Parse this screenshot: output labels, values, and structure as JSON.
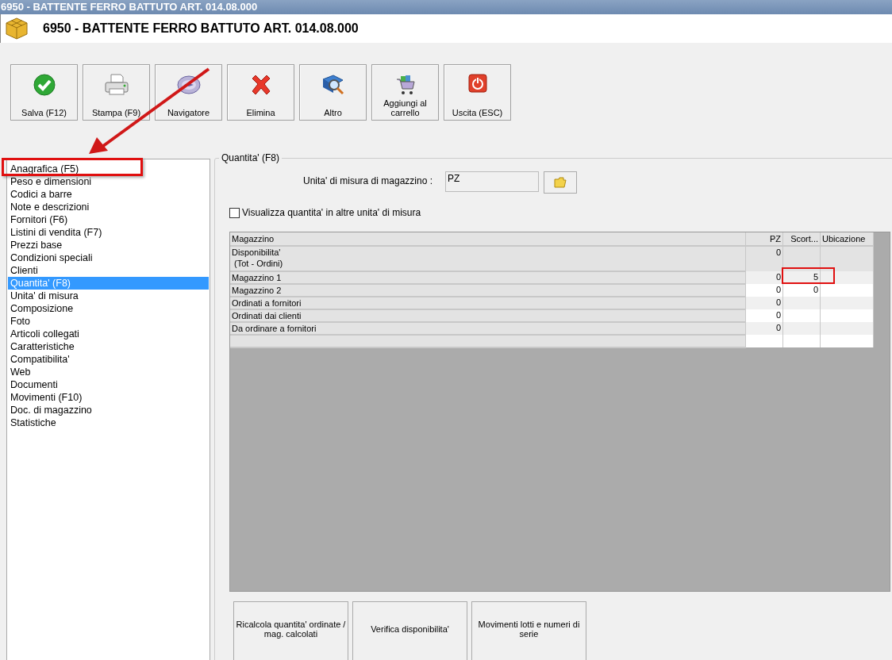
{
  "window": {
    "title": "6950 - BATTENTE FERRO BATTUTO ART. 014.08.000"
  },
  "header": {
    "title": "6950 - BATTENTE FERRO BATTUTO ART. 014.08.000"
  },
  "toolbar": [
    {
      "kind": "save",
      "label": "Salva (F12)"
    },
    {
      "kind": "print",
      "label": "Stampa (F9)"
    },
    {
      "kind": "navigator",
      "label": "Navigatore"
    },
    {
      "kind": "delete",
      "label": "Elimina"
    },
    {
      "kind": "more",
      "label": "Altro"
    },
    {
      "kind": "cart",
      "label": "Aggiungi al carrello"
    },
    {
      "kind": "exit",
      "label": "Uscita (ESC)"
    }
  ],
  "sidebar": {
    "items": [
      {
        "label": "Anagrafica (F5)",
        "selected": false
      },
      {
        "label": "Peso e dimensioni",
        "selected": false
      },
      {
        "label": "Codici a barre",
        "selected": false
      },
      {
        "label": "Note e descrizioni",
        "selected": false
      },
      {
        "label": "Fornitori (F6)",
        "selected": false
      },
      {
        "label": "Listini di vendita (F7)",
        "selected": false
      },
      {
        "label": "Prezzi base",
        "selected": false
      },
      {
        "label": "Condizioni speciali",
        "selected": false
      },
      {
        "label": "Clienti",
        "selected": false
      },
      {
        "label": "Quantita' (F8)",
        "selected": true
      },
      {
        "label": "Unita' di misura",
        "selected": false
      },
      {
        "label": "Composizione",
        "selected": false
      },
      {
        "label": "Foto",
        "selected": false
      },
      {
        "label": "Articoli collegati",
        "selected": false
      },
      {
        "label": "Caratteristiche",
        "selected": false
      },
      {
        "label": "Compatibilita'",
        "selected": false
      },
      {
        "label": "Web",
        "selected": false
      },
      {
        "label": "Documenti",
        "selected": false
      },
      {
        "label": "Movimenti (F10)",
        "selected": false
      },
      {
        "label": "Doc. di magazzino",
        "selected": false
      },
      {
        "label": "Statistiche",
        "selected": false
      }
    ]
  },
  "panel": {
    "title": "Quantita' (F8)",
    "unit_label": "Unita' di misura di magazzino :",
    "unit_value": "PZ",
    "checkbox": {
      "label": "Visualizza quantita' in altre unita' di misura",
      "checked": false
    },
    "table": {
      "columns": [
        "Magazzino",
        "PZ",
        "Scort...",
        "Ubicazione"
      ],
      "rows": [
        {
          "cells": [
            "Disponibilita'\n (Tot - Ordini)",
            "0",
            "",
            ""
          ]
        },
        {
          "cells": [
            "Magazzino 1",
            "0",
            "5",
            ""
          ]
        },
        {
          "cells": [
            "Magazzino 2",
            "0",
            "0",
            ""
          ]
        },
        {
          "cells": [
            "Ordinati a fornitori",
            "0",
            "",
            ""
          ]
        },
        {
          "cells": [
            "Ordinati dai clienti",
            "0",
            "",
            ""
          ]
        },
        {
          "cells": [
            "Da ordinare a fornitori",
            "0",
            "",
            ""
          ]
        },
        {
          "cells": [
            "",
            "",
            "",
            ""
          ]
        }
      ]
    },
    "buttons": [
      "Ricalcola quantita' ordinate / mag. calcolati",
      "Verifica disponibilita'",
      "Movimenti lotti e numeri di serie"
    ]
  }
}
